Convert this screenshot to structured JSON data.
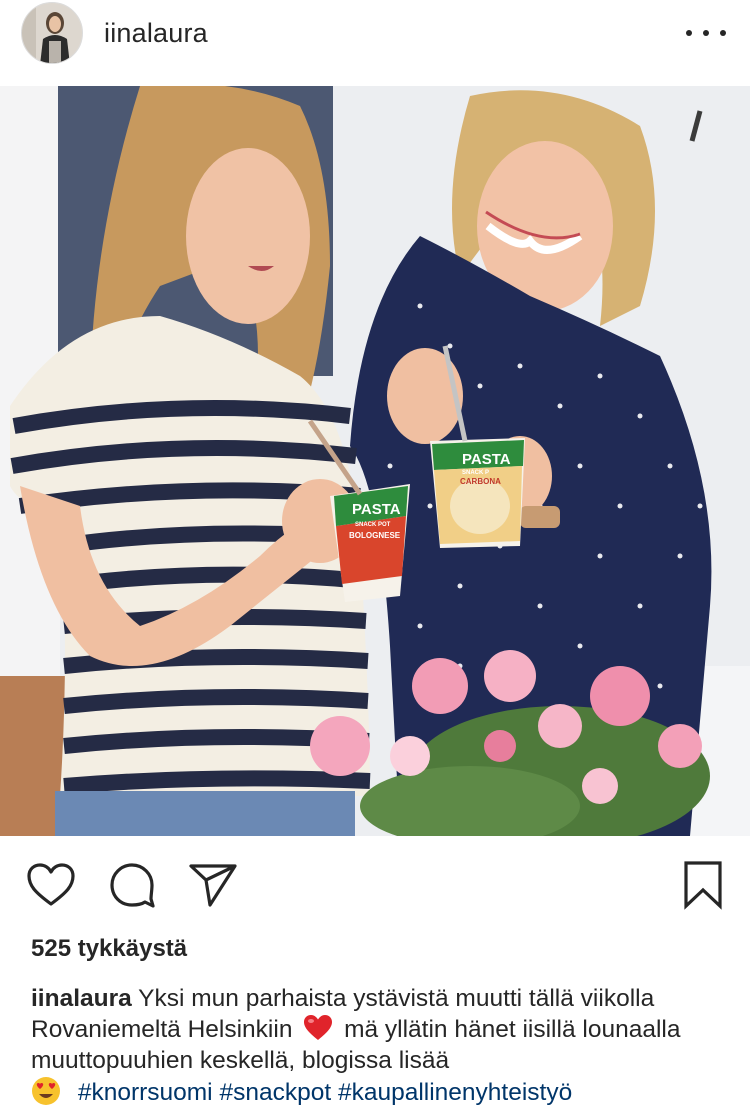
{
  "post": {
    "username": "iinalaura",
    "likes": "525 tykkäystä",
    "caption": {
      "username": "iinalaura",
      "text_part1": "Yksi mun parhaista ystävistä muutti tällä viikolla Rovaniemeltä Helsinkiin",
      "text_part2": "mä yllätin hänet iisillä lounaalla muuttopuuhien keskellä, blogissa lisää",
      "hashtags": [
        "#knorrsuomi",
        "#snackpot",
        "#kaupallinenyhteistyö"
      ]
    },
    "photo": {
      "cup_left_brand": "PASTA",
      "cup_left_sub": "SNACK POT",
      "cup_left_flavor": "BOLOGNESE",
      "cup_right_brand": "PASTA",
      "cup_right_sub": "SNACK P",
      "cup_right_flavor": "CARBONA"
    }
  },
  "icons": {
    "like": "heart-outline-icon",
    "comment": "comment-bubble-icon",
    "share": "paper-plane-icon",
    "save": "bookmark-icon",
    "more": "ellipsis-icon"
  },
  "colors": {
    "text": "#262626",
    "hashtag": "#003569",
    "emoji_heart": "#e0242b"
  }
}
